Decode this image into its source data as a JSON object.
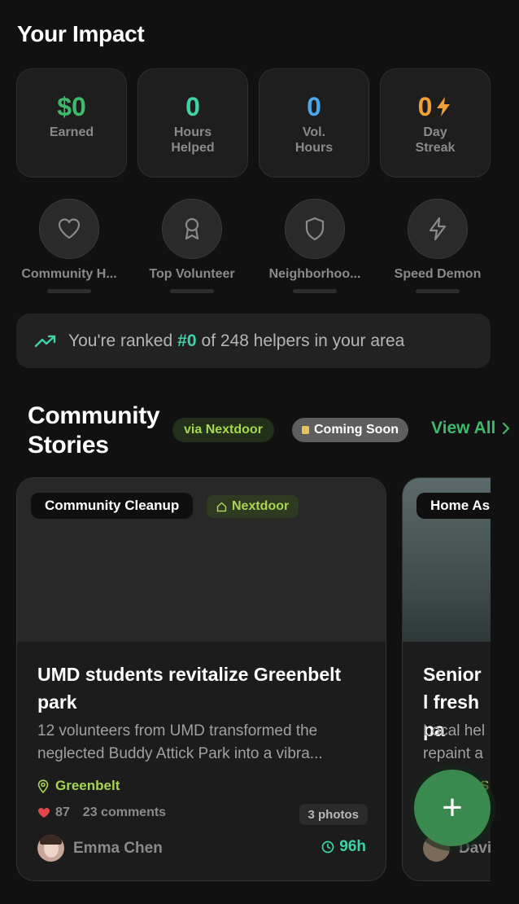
{
  "impact": {
    "title": "Your Impact",
    "stats": [
      {
        "value": "$0",
        "label": "Earned",
        "color": "#3fb96a"
      },
      {
        "value": "0",
        "label": "Hours\nHelped",
        "color": "#3ed2a6"
      },
      {
        "value": "0",
        "label": "Vol.\nHours",
        "color": "#4aa8ec"
      },
      {
        "value": "0",
        "label": "Day\nStreak",
        "color": "#f0a036",
        "icon": "lightning-icon"
      }
    ],
    "badges": [
      {
        "label": "Community H...",
        "icon": "heart-icon"
      },
      {
        "label": "Top Volunteer",
        "icon": "award-icon"
      },
      {
        "label": "Neighborhoo...",
        "icon": "shield-icon"
      },
      {
        "label": "Speed Demon",
        "icon": "lightning-icon"
      }
    ],
    "rank": {
      "prefix": "You're ranked",
      "rank": "#0",
      "suffix": "of 248 helpers in your area",
      "icon": "trending-up-icon"
    }
  },
  "stories": {
    "title": "Community Stories",
    "source_pill": "via Nextdoor",
    "status_pill": "Coming Soon",
    "view_all": "View All",
    "cards": [
      {
        "category": "Community Cleanup",
        "source": "Nextdoor",
        "title": "UMD students revitalize Greenbelt park",
        "excerpt": "12 volunteers from UMD transformed the neglected Buddy Attick Park into a vibra...",
        "location": "Greenbelt",
        "likes": "87",
        "comments": "23 comments",
        "photos": "3 photos",
        "author": "Emma Chen",
        "time_left": "96h"
      },
      {
        "category": "Home As",
        "title": "Senior l fresh pa",
        "excerpt": "Local hel repaint a",
        "location": "S",
        "author": "Davi"
      }
    ]
  },
  "fab": {
    "label": "+",
    "icon": "plus-icon"
  },
  "colors": {
    "background": "#111111",
    "accent_green": "#3fb96a",
    "accent_teal": "#3ed2a6",
    "nextdoor_lime": "#a8d552"
  }
}
